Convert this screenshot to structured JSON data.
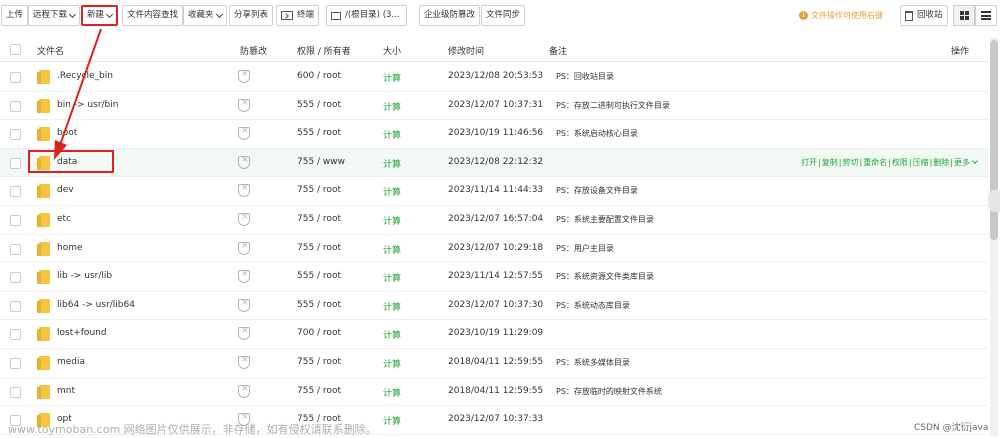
{
  "toolbar": {
    "upload": "上传",
    "remote_download": "远程下载",
    "new": "新建",
    "content_search": "文件内容查找",
    "favorites": "收藏夹",
    "share_list": "分享列表",
    "terminal": "终端",
    "root_dir": "/(根目录) (3...",
    "enterprise_tamper": "企业级防篡改",
    "file_sync": "文件同步",
    "tip": "文件操作可使用右键",
    "recycle_bin": "回收站"
  },
  "table": {
    "headers": {
      "name": "文件名",
      "tamper": "防篡改",
      "perm": "权限 / 所有者",
      "size": "大小",
      "mtime": "修改时间",
      "note": "备注",
      "ops": "操作"
    },
    "rows": [
      {
        "name": ".Recycle_bin",
        "perm": "600 / root",
        "size": "计算",
        "mtime": "2023/12/08 20:53:53",
        "note": "PS：回收站目录"
      },
      {
        "name": "bin -> usr/bin",
        "perm": "555 / root",
        "size": "计算",
        "mtime": "2023/12/07 10:37:31",
        "note": "PS：存放二进制可执行文件目录"
      },
      {
        "name": "boot",
        "perm": "555 / root",
        "size": "计算",
        "mtime": "2023/10/19 11:46:56",
        "note": "PS：系统启动核心目录"
      },
      {
        "name": "data",
        "perm": "755 / www",
        "size": "计算",
        "mtime": "2023/12/08 22:12:32",
        "note": ""
      },
      {
        "name": "dev",
        "perm": "755 / root",
        "size": "计算",
        "mtime": "2023/11/14 11:44:33",
        "note": "PS：存放设备文件目录"
      },
      {
        "name": "etc",
        "perm": "755 / root",
        "size": "计算",
        "mtime": "2023/12/07 16:57:04",
        "note": "PS：系统主要配置文件目录"
      },
      {
        "name": "home",
        "perm": "755 / root",
        "size": "计算",
        "mtime": "2023/12/07 10:29:18",
        "note": "PS：用户主目录"
      },
      {
        "name": "lib -> usr/lib",
        "perm": "555 / root",
        "size": "计算",
        "mtime": "2023/11/14 12:57:55",
        "note": "PS：系统资源文件类库目录"
      },
      {
        "name": "lib64 -> usr/lib64",
        "perm": "555 / root",
        "size": "计算",
        "mtime": "2023/12/07 10:37:30",
        "note": "PS：系统动态库目录"
      },
      {
        "name": "lost+found",
        "perm": "700 / root",
        "size": "计算",
        "mtime": "2023/10/19 11:29:09",
        "note": ""
      },
      {
        "name": "media",
        "perm": "755 / root",
        "size": "计算",
        "mtime": "2018/04/11 12:59:55",
        "note": "PS：系统多媒体目录"
      },
      {
        "name": "mnt",
        "perm": "755 / root",
        "size": "计算",
        "mtime": "2018/04/11 12:59:55",
        "note": "PS：存放临时的映射文件系统"
      },
      {
        "name": "opt",
        "perm": "755 / root",
        "size": "计算",
        "mtime": "2023/12/07 10:37:33",
        "note": ""
      }
    ],
    "row_actions": [
      "打开",
      "复制",
      "剪切",
      "重命名",
      "权限",
      "压缩",
      "删除",
      "更多"
    ]
  },
  "watermark": "www.toymoban.com 网络图片仅供展示，非存储，如有侵权请联系删除。",
  "csdn_credit": "CSDN @沈衍java",
  "colors": {
    "accent": "#20a53a",
    "warning": "#e6a23c",
    "annotation": "#e02020"
  }
}
